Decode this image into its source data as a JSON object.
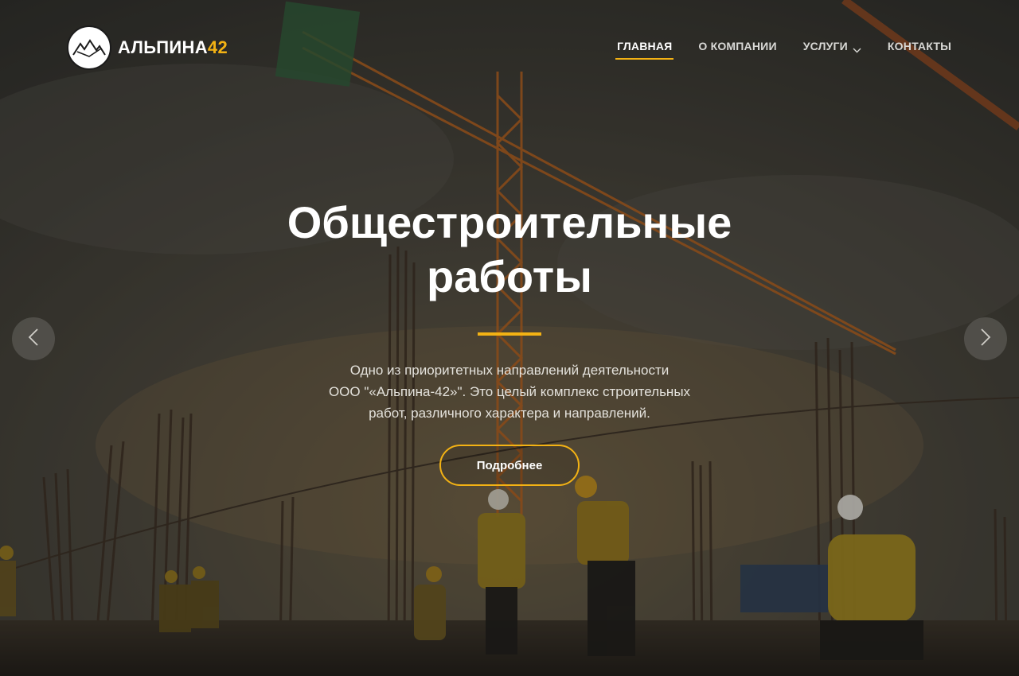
{
  "brand": {
    "name_main": "АЛЬПИНА",
    "name_accent": "42",
    "accent_color": "#f3b214"
  },
  "nav": {
    "items": [
      {
        "label": "ГЛАВНАЯ",
        "active": true
      },
      {
        "label": "О КОМПАНИИ",
        "active": false
      },
      {
        "label": "УСЛУГИ",
        "active": false,
        "icon": "chevron-down-icon"
      },
      {
        "label": "КОНТАКТЫ",
        "active": false
      }
    ]
  },
  "slide": {
    "title_lines": [
      "Общестроительные",
      "работы"
    ],
    "description_lines": [
      "Одно из приоритетных направлений деятельности",
      "ООО \"«Альпина-42»\". Это целый комплекс строительных",
      "работ, различного характера и направлений."
    ],
    "button_label": "Подробнее"
  },
  "slider": {
    "prev_icon": "chevron-left-icon",
    "next_icon": "chevron-right-icon"
  }
}
